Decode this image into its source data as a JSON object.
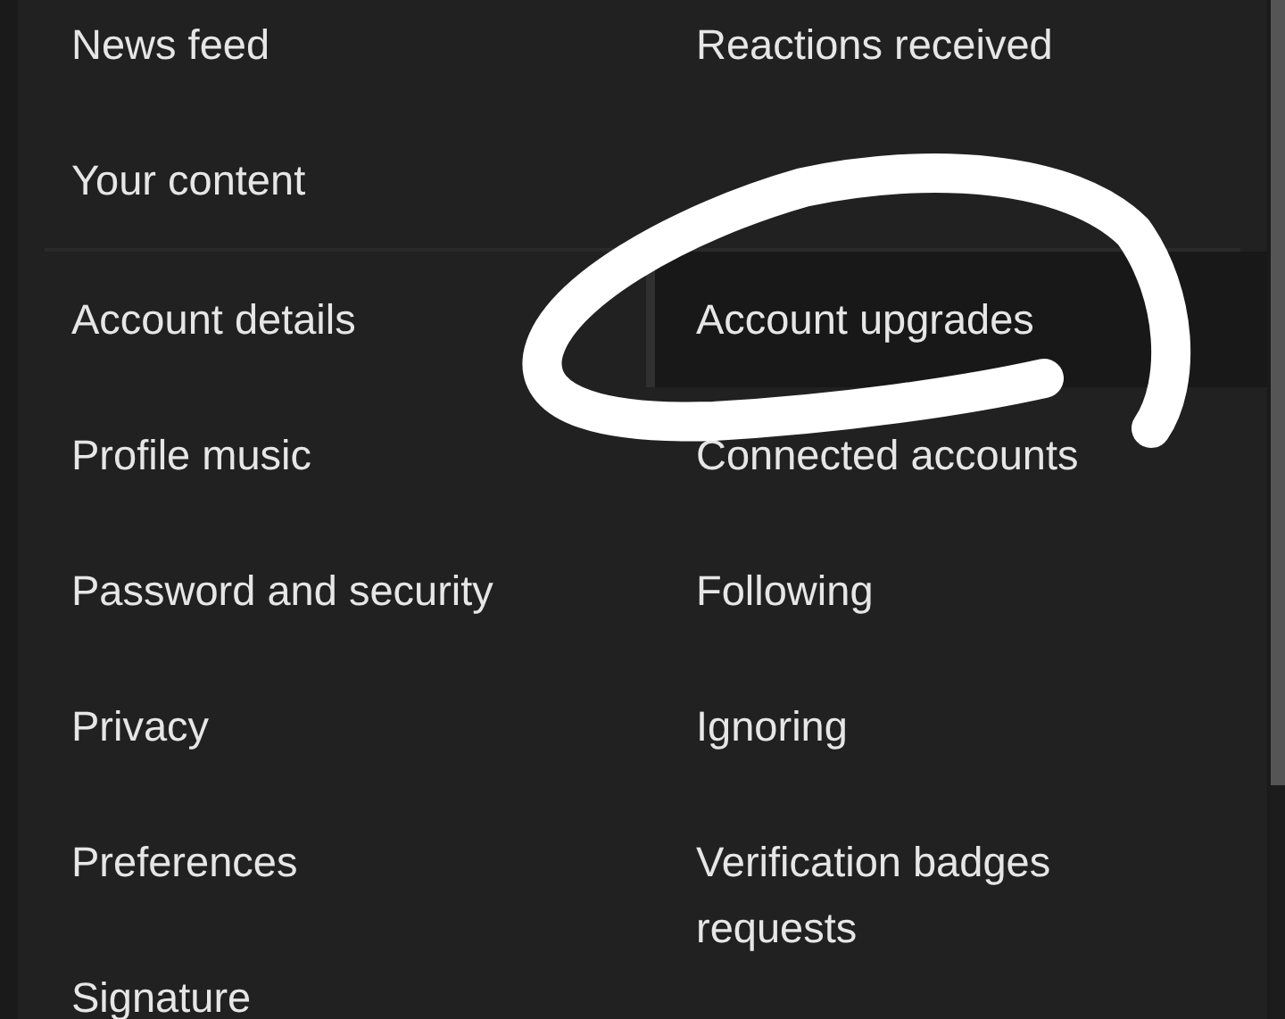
{
  "sections": [
    {
      "columns": [
        [
          {
            "label": "News feed",
            "selected": false
          },
          {
            "label": "Your content",
            "selected": false
          }
        ],
        [
          {
            "label": "Reactions received",
            "selected": false
          }
        ]
      ]
    },
    {
      "columns": [
        [
          {
            "label": "Account details",
            "selected": false
          },
          {
            "label": "Profile music",
            "selected": false
          },
          {
            "label": "Password and security",
            "selected": false
          },
          {
            "label": "Privacy",
            "selected": false
          },
          {
            "label": "Preferences",
            "selected": false
          },
          {
            "label": "Signature",
            "selected": false
          }
        ],
        [
          {
            "label": "Account upgrades",
            "selected": true
          },
          {
            "label": "Connected accounts",
            "selected": false
          },
          {
            "label": "Following",
            "selected": false
          },
          {
            "label": "Ignoring",
            "selected": false
          },
          {
            "label": "Verification badges requests",
            "selected": false
          }
        ]
      ]
    }
  ],
  "annotation": {
    "kind": "scribble"
  }
}
